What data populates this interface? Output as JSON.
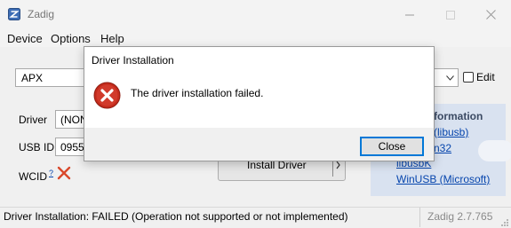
{
  "app": {
    "title": "Zadig",
    "menu": [
      "Device",
      "Options",
      "Help"
    ]
  },
  "main": {
    "device_value": "APX",
    "edit_label": "Edit",
    "driver_label": "Driver",
    "driver_value": "(NONI",
    "usbid_label": "USB ID",
    "usbid_value": "0955",
    "wcid_label": "WCID",
    "wcid_sup": "?",
    "install_label": "Install Driver"
  },
  "info": {
    "title": "formation",
    "links": [
      "(libusb)",
      "n32",
      "libusbK",
      "WinUSB (Microsoft)"
    ]
  },
  "status": {
    "text": "Driver Installation: FAILED (Operation not supported or not implemented)",
    "version": "Zadig 2.7.765"
  },
  "dialog": {
    "title": "Driver Installation",
    "message": "The driver installation failed.",
    "close_label": "Close"
  },
  "colors": {
    "error_red": "#c42b1c",
    "link_blue": "#0645ad",
    "accent": "#0078d7"
  }
}
